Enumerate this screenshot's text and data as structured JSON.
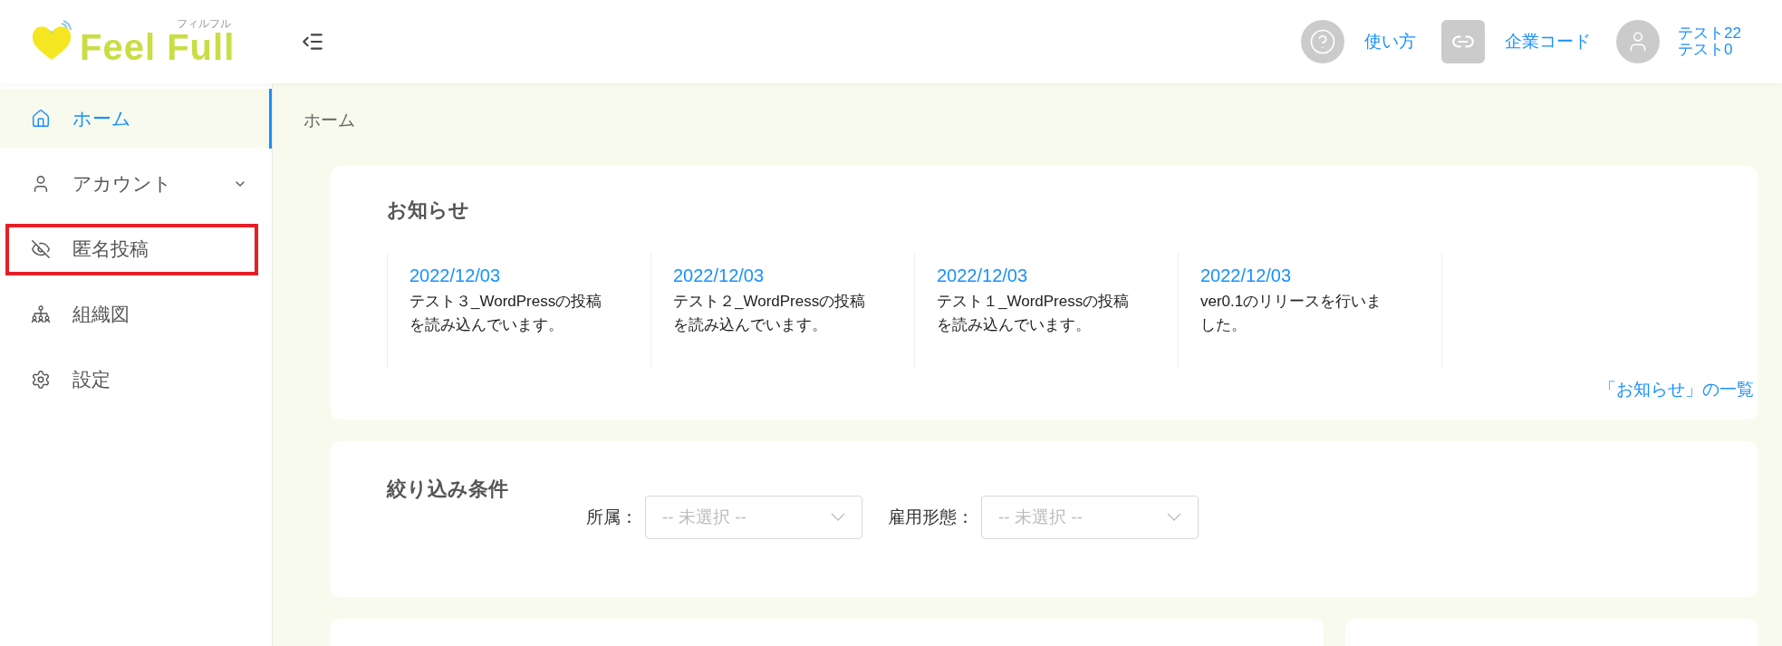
{
  "header": {
    "logo": {
      "name": "Feel Full",
      "kana": "フィルフル"
    },
    "help": "使い方",
    "company_code": "企業コード",
    "user": {
      "line_1": "テスト22",
      "line_2": "テスト0"
    }
  },
  "sidebar": {
    "items": [
      {
        "label": "ホーム",
        "selected": true,
        "expandable": false,
        "highlighted": false
      },
      {
        "label": "アカウント",
        "selected": false,
        "expandable": true,
        "highlighted": false
      },
      {
        "label": "匿名投稿",
        "selected": false,
        "expandable": false,
        "highlighted": true
      },
      {
        "label": "組織図",
        "selected": false,
        "expandable": false,
        "highlighted": false
      },
      {
        "label": "設定",
        "selected": false,
        "expandable": false,
        "highlighted": false
      }
    ]
  },
  "breadcrumb": "ホーム",
  "news": {
    "title": "お知らせ",
    "items": [
      {
        "date": "2022/12/03",
        "text": "テスト３_WordPressの投稿を読み込んでいます。"
      },
      {
        "date": "2022/12/03",
        "text": "テスト２_WordPressの投稿を読み込んでいます。"
      },
      {
        "date": "2022/12/03",
        "text": "テスト１_WordPressの投稿を読み込んでいます。"
      },
      {
        "date": "2022/12/03",
        "text": "ver0.1のリリースを行いました。"
      }
    ],
    "more_link": "「お知らせ」の一覧"
  },
  "filters": {
    "title": "絞り込み条件",
    "fields": [
      {
        "label": "所属：",
        "placeholder": "-- 未選択 --"
      },
      {
        "label": "雇用形態：",
        "placeholder": "-- 未選択 --"
      }
    ]
  }
}
